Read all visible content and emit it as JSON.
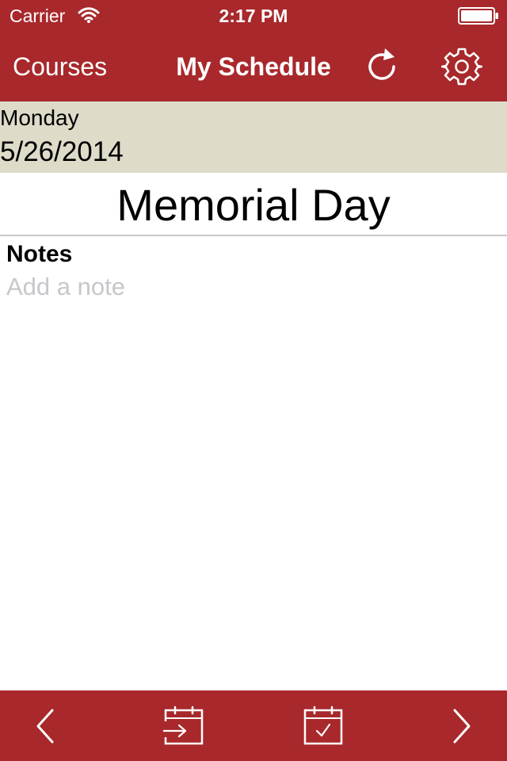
{
  "status_bar": {
    "carrier": "Carrier",
    "time": "2:17 PM"
  },
  "nav": {
    "left_label": "Courses",
    "title": "My Schedule",
    "refresh_icon": "refresh-icon",
    "settings_icon": "gear-icon"
  },
  "date_header": {
    "weekday": "Monday",
    "date": "5/26/2014"
  },
  "day": {
    "title": "Memorial Day"
  },
  "notes": {
    "label": "Notes",
    "placeholder": "Add a note",
    "value": ""
  },
  "toolbar": {
    "icons": [
      "chevron-left-icon",
      "calendar-export-icon",
      "calendar-check-icon",
      "chevron-right-icon"
    ]
  },
  "colors": {
    "brand": "#a8282b",
    "date_header_bg": "#dedbc9",
    "placeholder": "#c7c7cc"
  }
}
